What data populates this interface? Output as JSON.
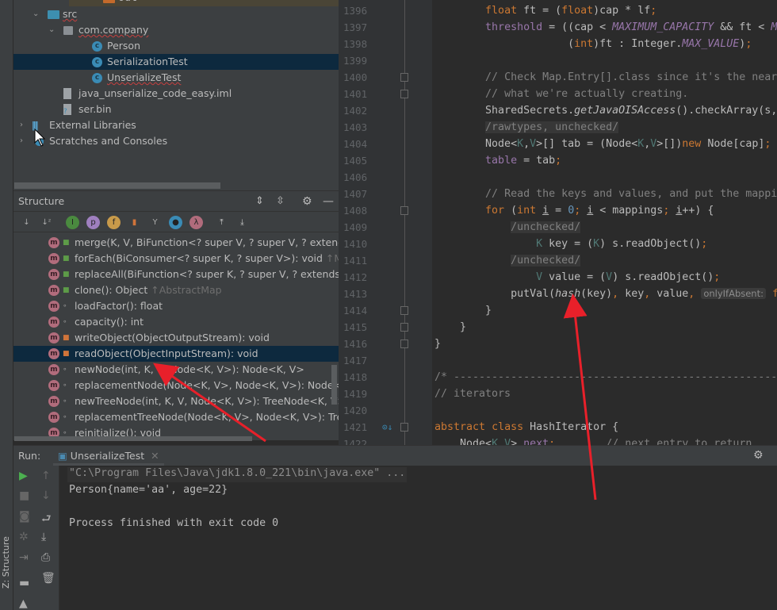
{
  "project_tree": {
    "items": [
      {
        "label": "out",
        "type": "folder-out",
        "indent": 1
      },
      {
        "label": "src",
        "type": "folder",
        "indent": 1,
        "expanded": true
      },
      {
        "label": "com.company",
        "type": "package",
        "indent": 2,
        "expanded": true
      },
      {
        "label": "Person",
        "type": "class",
        "indent": 3
      },
      {
        "label": "SerializationTest",
        "type": "class-runnable",
        "indent": 3,
        "selected": true
      },
      {
        "label": "UnserializeTest",
        "type": "class-runnable",
        "indent": 3
      },
      {
        "label": "java_unserialize_code_easy.iml",
        "type": "iml-file",
        "indent": 2
      },
      {
        "label": "ser.bin",
        "type": "unknown-file",
        "indent": 2
      },
      {
        "label": "External Libraries",
        "type": "libraries",
        "indent": 0
      },
      {
        "label": "Scratches and Consoles",
        "type": "scratches",
        "indent": 0
      }
    ]
  },
  "structure": {
    "title": "Structure",
    "items": [
      {
        "label": "merge(K, V, BiFunction<? super V, ? super V, ? extends V",
        "inherited": "",
        "visibility": "public"
      },
      {
        "label": "forEach(BiConsumer<? super K, ? super V>): void",
        "inherited": "↑Map",
        "visibility": "public"
      },
      {
        "label": "replaceAll(BiFunction<? super K, ? super V, ? extends V>)",
        "inherited": "",
        "visibility": "public"
      },
      {
        "label": "clone(): Object",
        "inherited": "↑AbstractMap",
        "visibility": "public"
      },
      {
        "label": "loadFactor(): float",
        "inherited": "",
        "visibility": "package"
      },
      {
        "label": "capacity(): int",
        "inherited": "",
        "visibility": "package"
      },
      {
        "label": "writeObject(ObjectOutputStream): void",
        "inherited": "",
        "visibility": "private"
      },
      {
        "label": "readObject(ObjectInputStream): void",
        "inherited": "",
        "visibility": "private",
        "selected": true
      },
      {
        "label": "newNode(int, K, V, Node<K, V>): Node<K, V>",
        "inherited": "",
        "visibility": "package"
      },
      {
        "label": "replacementNode(Node<K, V>, Node<K, V>): Node<K, V>",
        "inherited": "",
        "visibility": "package"
      },
      {
        "label": "newTreeNode(int, K, V, Node<K, V>): TreeNode<K, V>",
        "inherited": "",
        "visibility": "package"
      },
      {
        "label": "replacementTreeNode(Node<K, V>, Node<K, V>): TreeNode<K, V>",
        "inherited": "",
        "visibility": "package"
      },
      {
        "label": "reinitialize(): void",
        "inherited": "",
        "visibility": "package"
      }
    ]
  },
  "editor": {
    "lines": [
      {
        "n": "1396",
        "t": [
          [
            "        ",
            ""
          ],
          [
            "float",
            "kw"
          ],
          [
            " ft = (",
            ""
          ],
          [
            "float",
            "kw"
          ],
          [
            ")cap * lf",
            ""
          ],
          [
            ";",
            "sem"
          ]
        ]
      },
      {
        "n": "1397",
        "t": [
          [
            "        ",
            ""
          ],
          [
            "threshold",
            "fld"
          ],
          [
            " = ((cap < ",
            ""
          ],
          [
            "MAXIMUM_CAPACITY",
            "st"
          ],
          [
            " && ft < ",
            ""
          ],
          [
            "M",
            "st"
          ]
        ]
      },
      {
        "n": "1398",
        "t": [
          [
            "                     (",
            ""
          ],
          [
            "int",
            "kw"
          ],
          [
            ")ft : Integer.",
            ""
          ],
          [
            "MAX_VALUE",
            "st"
          ],
          [
            ")",
            ""
          ],
          [
            ";",
            "sem"
          ]
        ]
      },
      {
        "n": "1399",
        "t": []
      },
      {
        "n": "1400",
        "t": [
          [
            "        ",
            ""
          ],
          [
            "// Check Map.Entry[].class since it's the near",
            "cm"
          ]
        ]
      },
      {
        "n": "1401",
        "t": [
          [
            "        ",
            ""
          ],
          [
            "// what we're actually creating.",
            "cm"
          ]
        ]
      },
      {
        "n": "1402",
        "t": [
          [
            "        SharedSecrets.",
            ""
          ],
          [
            "getJavaOISAccess",
            "it"
          ],
          [
            "().checkArray(s,",
            ""
          ]
        ]
      },
      {
        "n": "1403",
        "t": [
          [
            "        ",
            ""
          ],
          [
            "/rawtypes, unchecked/",
            "sup"
          ]
        ]
      },
      {
        "n": "1404",
        "t": [
          [
            "        Node<",
            ""
          ],
          [
            "K",
            "tp"
          ],
          [
            ",",
            ""
          ],
          [
            "V",
            "tp"
          ],
          [
            ">[] tab = (Node<",
            ""
          ],
          [
            "K",
            "tp"
          ],
          [
            ",",
            ""
          ],
          [
            "V",
            "tp"
          ],
          [
            ">[])",
            ""
          ],
          [
            "new",
            "kw"
          ],
          [
            " Node[cap]",
            ""
          ],
          [
            ";",
            "sem"
          ]
        ]
      },
      {
        "n": "1405",
        "t": [
          [
            "        ",
            ""
          ],
          [
            "table",
            "fld"
          ],
          [
            " = tab",
            ""
          ],
          [
            ";",
            "sem"
          ]
        ]
      },
      {
        "n": "1406",
        "t": []
      },
      {
        "n": "1407",
        "t": [
          [
            "        ",
            ""
          ],
          [
            "// Read the keys and values, and put the mappi",
            "cm"
          ]
        ]
      },
      {
        "n": "1408",
        "t": [
          [
            "        ",
            ""
          ],
          [
            "for",
            "kw"
          ],
          [
            " (",
            ""
          ],
          [
            "int",
            "kw"
          ],
          [
            " ",
            ""
          ],
          [
            "i",
            "ul"
          ],
          [
            " = ",
            ""
          ],
          [
            "0",
            "num"
          ],
          [
            ";",
            "sem"
          ],
          [
            " ",
            ""
          ],
          [
            "i",
            "ul"
          ],
          [
            " < mappings",
            ""
          ],
          [
            ";",
            "sem"
          ],
          [
            " ",
            ""
          ],
          [
            "i",
            "ul"
          ],
          [
            "++) {",
            ""
          ]
        ]
      },
      {
        "n": "1409",
        "t": [
          [
            "            ",
            ""
          ],
          [
            "/unchecked/",
            "sup"
          ]
        ]
      },
      {
        "n": "1410",
        "t": [
          [
            "                ",
            ""
          ],
          [
            "K",
            "tp"
          ],
          [
            " key = (",
            ""
          ],
          [
            "K",
            "tp"
          ],
          [
            ") s.readObject()",
            ""
          ],
          [
            ";",
            "sem"
          ]
        ]
      },
      {
        "n": "1411",
        "t": [
          [
            "            ",
            ""
          ],
          [
            "/unchecked/",
            "sup"
          ]
        ]
      },
      {
        "n": "1412",
        "t": [
          [
            "                ",
            ""
          ],
          [
            "V",
            "tp"
          ],
          [
            " value = (",
            ""
          ],
          [
            "V",
            "tp"
          ],
          [
            ") s.readObject()",
            ""
          ],
          [
            ";",
            "sem"
          ]
        ]
      },
      {
        "n": "1413",
        "t": [
          [
            "            putVal(",
            ""
          ],
          [
            "hash",
            "it"
          ],
          [
            "(key)",
            ""
          ],
          [
            ",",
            "sem"
          ],
          [
            " key",
            ""
          ],
          [
            ",",
            "sem"
          ],
          [
            " value",
            ""
          ],
          [
            ",",
            "sem"
          ],
          [
            " ",
            ""
          ],
          [
            "onlyIfAbsent:",
            "hint"
          ],
          [
            " f",
            "kw"
          ]
        ]
      },
      {
        "n": "1414",
        "t": [
          [
            "        }",
            ""
          ]
        ]
      },
      {
        "n": "1415",
        "t": [
          [
            "    }",
            ""
          ]
        ]
      },
      {
        "n": "1416",
        "t": [
          [
            "}",
            ""
          ]
        ]
      },
      {
        "n": "1417",
        "t": []
      },
      {
        "n": "1418",
        "t": [
          [
            "/* -----------------------------------------------------",
            "cm"
          ]
        ]
      },
      {
        "n": "1419",
        "t": [
          [
            "// iterators",
            "cm"
          ]
        ]
      },
      {
        "n": "1420",
        "t": []
      },
      {
        "n": "1421",
        "t": [
          [
            "abstract",
            "kw"
          ],
          [
            " ",
            ""
          ],
          [
            "class",
            "kw"
          ],
          [
            " HashIterator {",
            ""
          ]
        ]
      },
      {
        "n": "1422",
        "t": [
          [
            "    Node<",
            ""
          ],
          [
            "K",
            "tp"
          ],
          [
            ",",
            ""
          ],
          [
            "V",
            "tp"
          ],
          [
            "> ",
            ""
          ],
          [
            "next",
            "fld"
          ],
          [
            ";",
            "sem"
          ],
          [
            "        ",
            ""
          ],
          [
            "// next entry to return",
            "cm"
          ]
        ]
      }
    ]
  },
  "run": {
    "label": "Run:",
    "tab": "UnserializeTest",
    "output": [
      "\"C:\\Program Files\\Java\\jdk1.8.0_221\\bin\\java.exe\" ...",
      "Person{name='aa', age=22}",
      "",
      "Process finished with exit code 0"
    ]
  },
  "sidebar": {
    "structure_tab": "Z: Structure"
  },
  "colors": {
    "selection": "#0d293e",
    "annotation_arrow": "#e8202a",
    "keyword": "#cc7832",
    "field": "#9876aa"
  }
}
